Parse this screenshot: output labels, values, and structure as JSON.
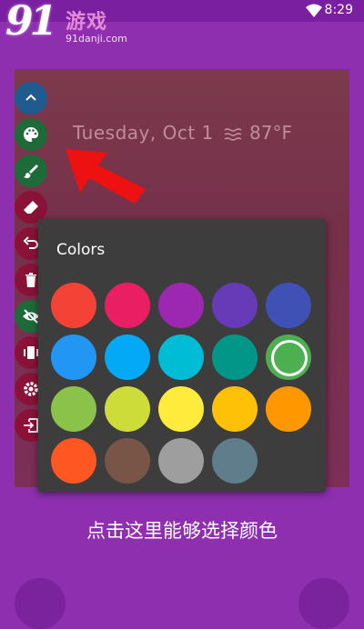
{
  "status_bar": {
    "time": "8:29"
  },
  "watermark": {
    "number": "91",
    "title": "游戏",
    "url": "91danji.com"
  },
  "preview": {
    "date": "Tuesday, Oct 1",
    "temperature": "87°F"
  },
  "toolbar": {
    "items": [
      {
        "name": "collapse",
        "icon": "chevron-up-icon",
        "color": "#1f5b8e"
      },
      {
        "name": "colors",
        "icon": "palette-icon",
        "color": "#1e6b3a"
      },
      {
        "name": "brush",
        "icon": "brush-icon",
        "color": "#1e6b3a"
      },
      {
        "name": "eraser",
        "icon": "eraser-icon",
        "color": "#8a1238"
      },
      {
        "name": "undo",
        "icon": "undo-icon",
        "color": "#8a1238"
      },
      {
        "name": "delete",
        "icon": "trash-icon",
        "color": "#8a1238"
      },
      {
        "name": "hide",
        "icon": "eye-off-icon",
        "color": "#1e6b3a"
      },
      {
        "name": "vibrate",
        "icon": "vibrate-icon",
        "color": "#8a1238"
      },
      {
        "name": "settings",
        "icon": "gear-icon",
        "color": "#8a1238"
      },
      {
        "name": "exit",
        "icon": "exit-icon",
        "color": "#8a1238"
      }
    ]
  },
  "colors_panel": {
    "title": "Colors",
    "swatches": [
      {
        "color": "#f44336"
      },
      {
        "color": "#e91e63"
      },
      {
        "color": "#9c27b0"
      },
      {
        "color": "#673ab7"
      },
      {
        "color": "#3f51b5"
      },
      {
        "color": "#2196f3"
      },
      {
        "color": "#03a9f4"
      },
      {
        "color": "#00bcd4"
      },
      {
        "color": "#009688"
      },
      {
        "color": "#4caf50",
        "selected": true
      },
      {
        "color": "#8bc34a"
      },
      {
        "color": "#cddc39"
      },
      {
        "color": "#ffeb3b"
      },
      {
        "color": "#ffc107"
      },
      {
        "color": "#ff9800"
      },
      {
        "color": "#ff5722"
      },
      {
        "color": "#795548"
      },
      {
        "color": "#9e9e9e"
      },
      {
        "color": "#607d8b"
      }
    ]
  },
  "caption": "点击这里能够选择颜色"
}
